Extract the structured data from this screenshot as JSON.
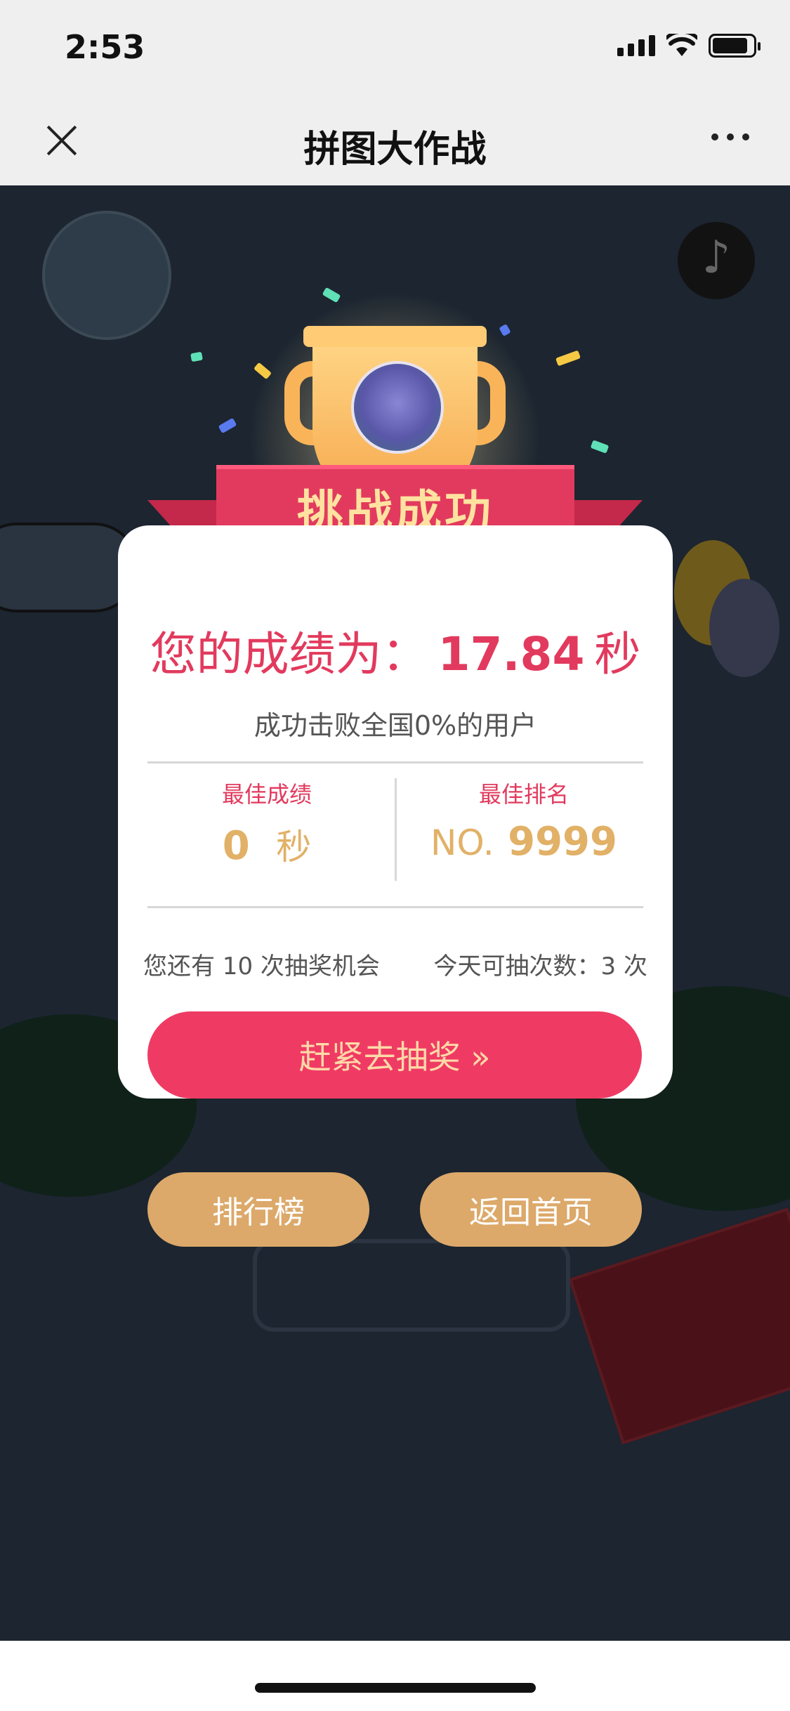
{
  "status_bar": {
    "time": "2:53"
  },
  "nav": {
    "title": "拼图大作战"
  },
  "banner": {
    "text": "挑战成功"
  },
  "result": {
    "score_prefix": "您的成绩为：",
    "score_value": "17.84",
    "score_unit": "秒",
    "beat_text": "成功击败全国0%的用户"
  },
  "stats": {
    "best_score_label": "最佳成绩",
    "best_score_value": "0",
    "best_score_unit": "秒",
    "best_rank_label": "最佳排名",
    "best_rank_prefix": "NO.",
    "best_rank_value": "9999"
  },
  "chances": {
    "remaining": "您还有 10 次抽奖机会",
    "today": "今天可抽次数：3 次"
  },
  "buttons": {
    "lottery": "赶紧去抽奖 »",
    "leaderboard": "排行榜",
    "home": "返回首页"
  },
  "colors": {
    "accent": "#ef3b64",
    "gold": "#dca96a",
    "background_dark": "#1c2530"
  }
}
